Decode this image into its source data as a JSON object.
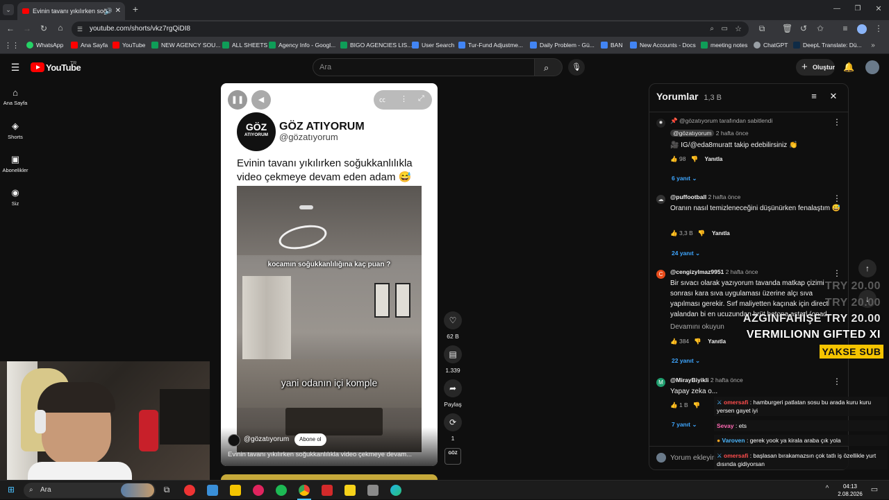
{
  "browser": {
    "tab_title": "Evinin tavanı yıkılırken soğu",
    "url": "youtube.com/shorts/vkz7rgQiDI8",
    "bookmarks": [
      {
        "label": "WhatsApp",
        "color": "#25d366"
      },
      {
        "label": "Ana Sayfa",
        "color": "#ff0000"
      },
      {
        "label": "YouTube",
        "color": "#ff0000"
      },
      {
        "label": "NEW AGENCY SOU...",
        "color": "#0f9d58"
      },
      {
        "label": "ALL SHEETS",
        "color": "#0f9d58"
      },
      {
        "label": "Agency Info - Googl...",
        "color": "#0f9d58"
      },
      {
        "label": "BIGO AGENCIES LIS...",
        "color": "#0f9d58"
      },
      {
        "label": "User Search",
        "color": "#4285f4"
      },
      {
        "label": "Tur-Fund Adjustme...",
        "color": "#4285f4"
      },
      {
        "label": "Daily Problem - Gü...",
        "color": "#4285f4"
      },
      {
        "label": "BAN",
        "color": "#4285f4"
      },
      {
        "label": "New Accounts - Docs",
        "color": "#4285f4"
      },
      {
        "label": "meeting notes",
        "color": "#0f9d58"
      },
      {
        "label": "ChatGPT",
        "color": "#9aa0a6"
      },
      {
        "label": "DeepL Translate: Dü...",
        "color": "#0f2b46"
      }
    ]
  },
  "yt": {
    "logo_text": "YouTube",
    "country": "TR",
    "search_placeholder": "Ara",
    "create_label": "Oluştur",
    "sidebar": [
      "Ana Sayfa",
      "Shorts",
      "Abonelikler",
      "Siz"
    ]
  },
  "short": {
    "channel_display": "GÖZ ATIYORUM",
    "channel_handle": "@gözatıyorum",
    "logo_top": "GÖZ",
    "logo_bottom": "ATIYORUM",
    "headline": "Evinin tavanı yıkılırken soğukkanlılıkla video çekmeye devam eden adam 😅",
    "overlay_caption": "kocamın soğukkanlılığına kaç puan ?",
    "subtitle": "yani odanın içi komple",
    "footer_handle": "@gözatıyorum",
    "subscribe_label": "Abone ol",
    "footer_title": "Evinin tavanı yıkılırken soğukkanlılıkla video çekmeye devam...",
    "likes": "62 B",
    "comments_count": "1.339",
    "share_label": "Paylaş",
    "remix_count": "1"
  },
  "comments": {
    "title": "Yorumlar",
    "count": "1,3 B",
    "input_placeholder": "Yorum ekleyin...",
    "items": [
      {
        "pinned_by": "@gözatıyorum tarafından sabitlendi",
        "author": "@gözatıyorum",
        "time": "2 hafta önce",
        "text": "🎥 IG/@eda8muratt takip edebilirsiniz 👏",
        "likes": "98",
        "reply": "Yanıtla",
        "replies": "6 yanıt"
      },
      {
        "author": "@puffootball",
        "time": "2 hafta önce",
        "text": "Oranın nasıl temizleneceğini düşünürken fenalaştım 😅",
        "likes": "3,3 B",
        "reply": "Yanıtla",
        "replies": "24 yanıt"
      },
      {
        "author": "@cengizylmaz9951",
        "time": "2 hafta önce",
        "text": "Bir sıvacı olarak yazıyorum tavanda matkap çizimi sonrası kara sıva uygulaması üzerine alçı sıva yapılması gerekir. Sırf maliyetten kaçınak için direct yalandan bi en ucuzundan brüt betona astarl (onad",
        "more": "Devamını okuyun",
        "likes": "384",
        "reply": "Yanıtla",
        "replies": "22 yanıt"
      },
      {
        "author": "@MirayBiyikli",
        "time": "2 hafta önce",
        "text": "Yapay zeka o...",
        "likes": "1 B",
        "reply": "Yanıtla",
        "replies": "7 yanıt"
      }
    ]
  },
  "stream_overlay": {
    "donors": [
      {
        "text": "TRY 20.00",
        "color": "#5a5a5a"
      },
      {
        "text": "TRY 20.00",
        "color": "#5a5a5a"
      },
      {
        "text": "AZGINFAHİŞE  TRY 20.00",
        "color": "#e8e8e8"
      },
      {
        "text": "VERMILIONN  GIFTED XI",
        "color": "#ffffff"
      }
    ],
    "badge": "YAKSE SUB",
    "chat": [
      {
        "user": "omersafi",
        "user_color": "#ff4d4d",
        "text": "hamburgeri patlatan sosu bu arada kuru kuru yersen gayet iyi"
      },
      {
        "user": "Sevay",
        "user_color": "#ff69b4",
        "text": "ets"
      },
      {
        "user": "Varoven",
        "user_color": "#4db8ff",
        "text": "gerek yook ya kirala araba çık yola"
      },
      {
        "user": "omersafi",
        "user_color": "#ff4d4d",
        "text": "başlasan bırakamazsın çok tatlı iş özellikle yurt dısında gidiyorsan"
      }
    ]
  },
  "taskbar": {
    "search_label": "Ara",
    "time": "04:13",
    "date": "2.08.2026"
  }
}
